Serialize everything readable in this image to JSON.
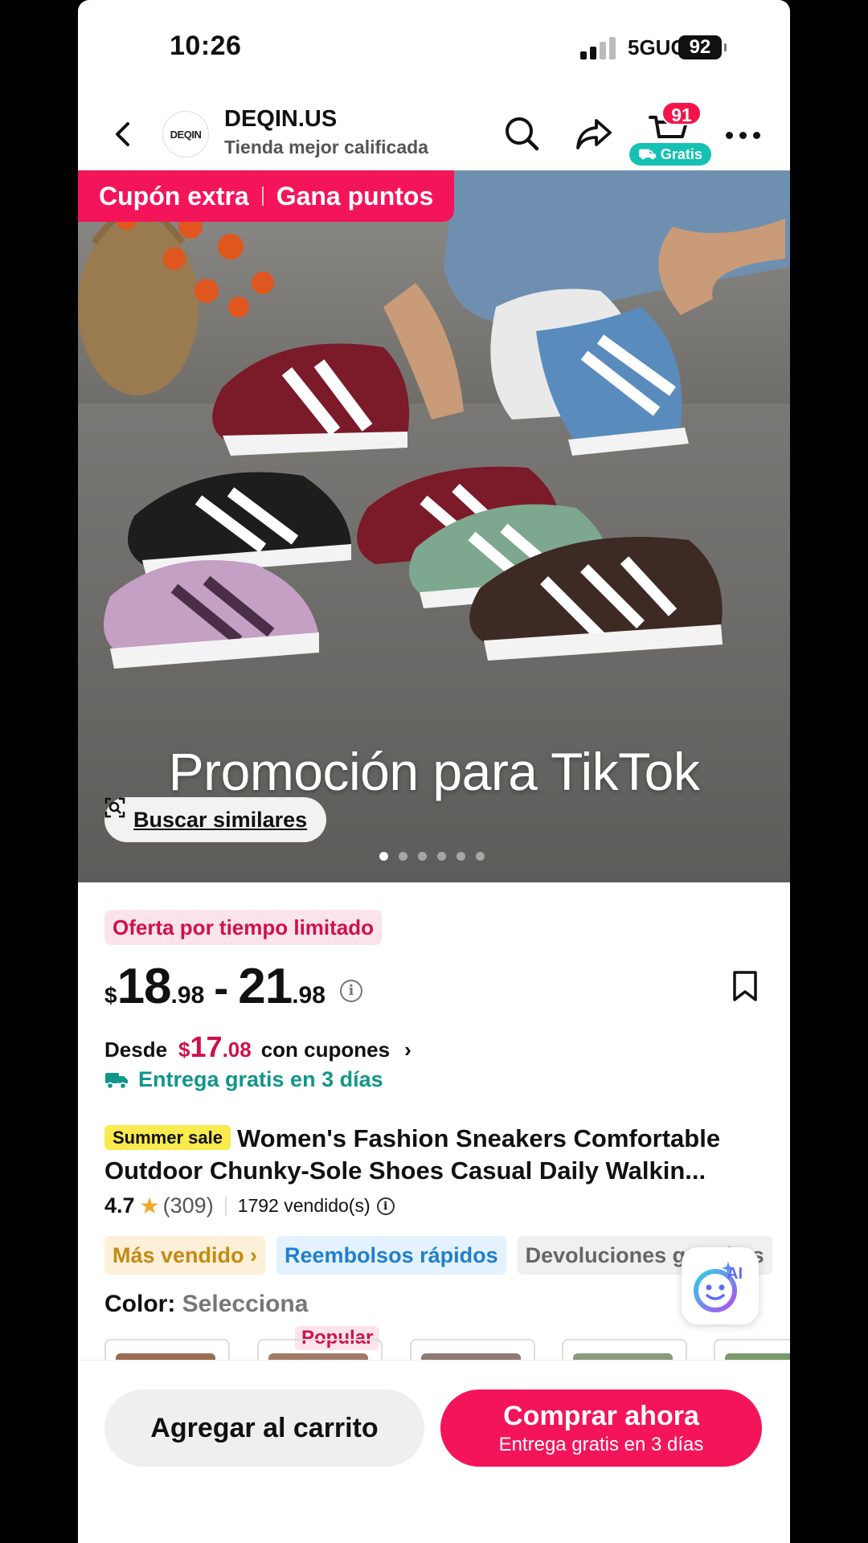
{
  "status_bar": {
    "time": "10:26",
    "network": "5GUC",
    "battery": "92"
  },
  "header": {
    "logo_text": "DEQIN",
    "store_name": "DEQIN.US",
    "store_subtitle": "Tienda mejor calificada",
    "cart_count": "91",
    "cart_free_label": "Gratis",
    "icons": [
      "back-icon",
      "search-icon",
      "share-icon",
      "cart-icon",
      "more-icon"
    ]
  },
  "hero": {
    "coupon_label": "Cupón extra",
    "points_label": "Gana puntos",
    "promo_overlay": "Promoción para TikTok",
    "similar_button": "Buscar similares",
    "image_index": 1,
    "image_count": 6
  },
  "product": {
    "offer_badge": "Oferta por tiempo limitado",
    "price": {
      "currency": "$",
      "min_whole": "18",
      "min_decimal": ".98",
      "max_whole": "21",
      "max_decimal": ".98",
      "separator": "-"
    },
    "from_label": "Desde",
    "coupon_price_currency": "$",
    "coupon_price_whole": "17",
    "coupon_price_decimal": ".08",
    "coupon_suffix": "con cupones",
    "delivery": "Entrega gratis en 3 días",
    "sale_tag": "Summer sale",
    "title": "Women's Fashion Sneakers Comfortable Outdoor Chunky-Sole Shoes Casual Daily Walkin...",
    "rating": "4.7",
    "reviews": "(309)",
    "sold": "1792 vendido(s)",
    "chips": [
      "Más vendido",
      "Reembolsos rápidos",
      "Devoluciones gratuitas"
    ],
    "color_label": "Color:",
    "color_value": "Selecciona",
    "popular_badge": "Popular",
    "ai_label": "AI"
  },
  "bottom_bar": {
    "add_to_cart": "Agregar al carrito",
    "buy_now": "Comprar ahora",
    "buy_now_sub": "Entrega gratis en 3 días"
  },
  "colors": {
    "brand_pink": "#f4145a",
    "teal": "#12968a",
    "sale_yellow": "#f9ea4d"
  }
}
